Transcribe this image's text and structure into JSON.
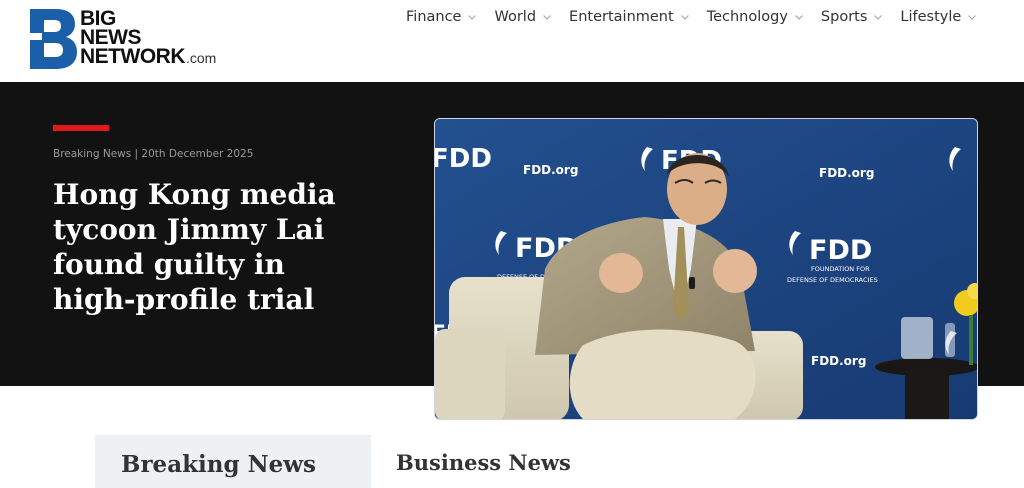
{
  "brand": {
    "line1": "BIG",
    "line2": "NEWS",
    "line3": "NETWORK",
    "suffix": ".com",
    "color": "#1a5fa8"
  },
  "nav": {
    "items": [
      {
        "label": "Finance"
      },
      {
        "label": "World"
      },
      {
        "label": "Entertainment"
      },
      {
        "label": "Technology"
      },
      {
        "label": "Sports"
      },
      {
        "label": "Lifestyle"
      }
    ]
  },
  "hero": {
    "meta": "Breaking News | 20th December 2025",
    "headline": "Hong Kong media tycoon Jimmy Lai found guilty in high-profile trial",
    "accent_color": "#e01a1a",
    "image": {
      "backdrop_text_site": "FDD.org",
      "backdrop_text_logo": "FDD",
      "backdrop_text_sub1": "FOUNDATION FOR",
      "backdrop_text_sub2": "DEFENSE OF DEMOCRACIES"
    }
  },
  "sections": {
    "breaking": "Breaking News",
    "business": "Business News"
  }
}
